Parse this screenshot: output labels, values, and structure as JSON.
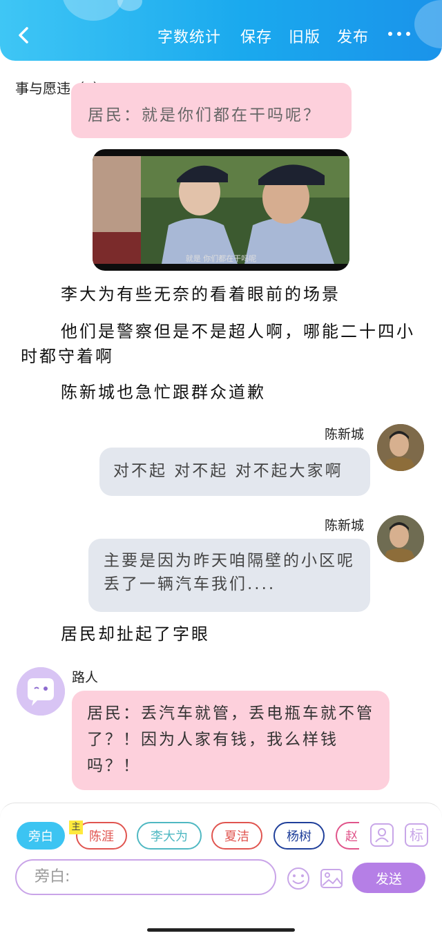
{
  "header": {
    "back_label": "<",
    "menu": [
      "字数统计",
      "保存",
      "旧版",
      "发布"
    ],
    "more_label": "•••"
  },
  "chapter_title": "事与愿违（1）",
  "messages": [
    {
      "type": "bubble_partial",
      "text": "居民：就是你们都在干吗呢？"
    },
    {
      "type": "image",
      "caption": "就是 你们都在干吗呢"
    },
    {
      "type": "narration",
      "text": "李大为有些无奈的看着眼前的场景"
    },
    {
      "type": "narration",
      "text": "他们是警察但是不是超人啊，哪能二十四小时都守着啊"
    },
    {
      "type": "narration",
      "text": "陈新城也急忙跟群众道歉"
    },
    {
      "type": "chat",
      "name": "陈新城",
      "text": "对不起 对不起 对不起大家啊"
    },
    {
      "type": "chat",
      "name": "陈新城",
      "text": "主要是因为昨天咱隔壁的小区呢丢了一辆汽车我们...."
    },
    {
      "type": "narration",
      "text": "居民却扯起了字眼"
    },
    {
      "type": "chat",
      "name": "路人",
      "text": "居民：丢汽车就管，丢电瓶车就不管了？！因为人家有钱，我么样钱吗？！"
    }
  ],
  "toolbar": {
    "chips": [
      {
        "label": "旁白",
        "selected": true
      },
      {
        "label": "陈涯",
        "badge": "主",
        "color": "#e0544f"
      },
      {
        "label": "李大为",
        "color": "#4fb8c2"
      },
      {
        "label": "夏洁",
        "color": "#e0544f"
      },
      {
        "label": "杨树",
        "color": "#1f3f9a"
      },
      {
        "label": "赵",
        "color": "#e0548a"
      }
    ],
    "input_placeholder": "旁白:",
    "send_label": "发送",
    "mark_label": "标"
  },
  "colors": {
    "header_start": "#3fc6f5",
    "header_end": "#1a93ea",
    "pink_bubble": "#fdd0dc",
    "gray_bubble": "#e3e7ee",
    "accent_purple": "#b57fe6",
    "selected_chip": "#3cc4f2"
  }
}
